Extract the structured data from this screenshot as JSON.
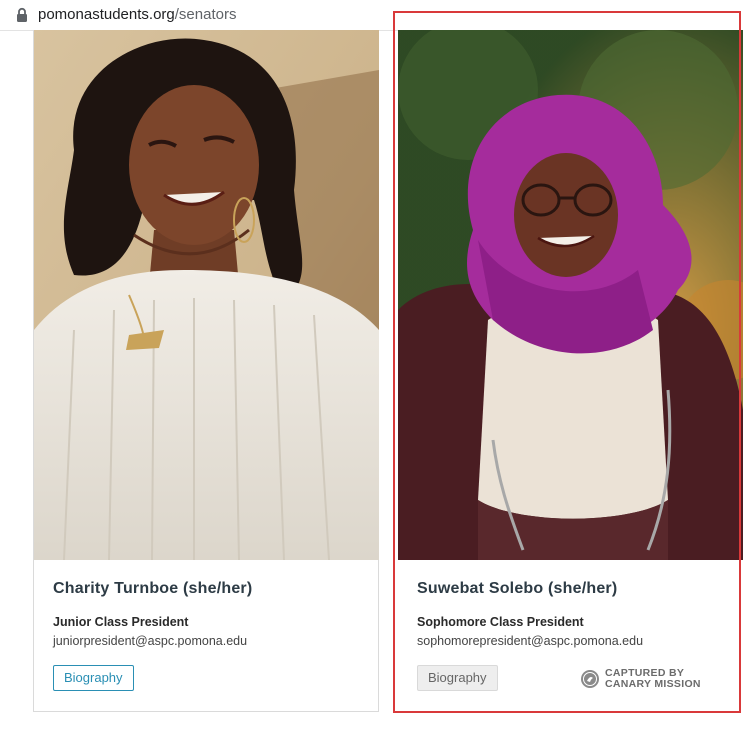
{
  "browser": {
    "url_domain": "pomonastudents.org",
    "url_path": "/senators"
  },
  "cards": [
    {
      "name": "Charity Turnboe (she/her)",
      "role": "Junior Class President",
      "email": "juniorpresident@aspc.pomona.edu",
      "button_label": "Biography"
    },
    {
      "name": "Suwebat Solebo (she/her)",
      "role": "Sophomore Class President",
      "email": "sophomorepresident@aspc.pomona.edu",
      "button_label": "Biography"
    }
  ],
  "watermark": {
    "line1": "CAPTURED BY",
    "line2": "CANARY MISSION"
  },
  "colors": {
    "highlight_border": "#d9393a",
    "link_accent": "#2a8fb4",
    "name_text": "#2d3b45"
  },
  "icons": [
    "lock-icon",
    "seal-icon"
  ]
}
